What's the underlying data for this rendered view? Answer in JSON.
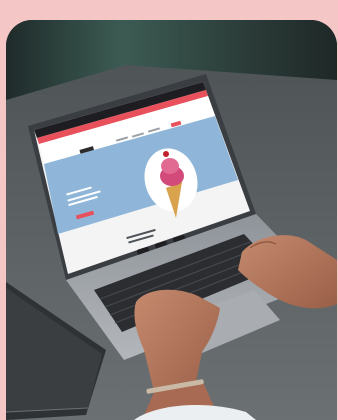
{
  "photo": {
    "subject": "photo-laptop-on-desk",
    "colors": {
      "page_bg": "#f5c6c6",
      "wall": "#2c3d3a",
      "desk": "#5f6466",
      "laptop_body": "#9ea3a8",
      "screen_brand_band": "#e8505b",
      "screen_hero_bg": "#8fb6d9",
      "notebook": "#35383b"
    }
  },
  "site": {
    "hero_button": "",
    "hero_caption": "",
    "icons_caption": ""
  }
}
